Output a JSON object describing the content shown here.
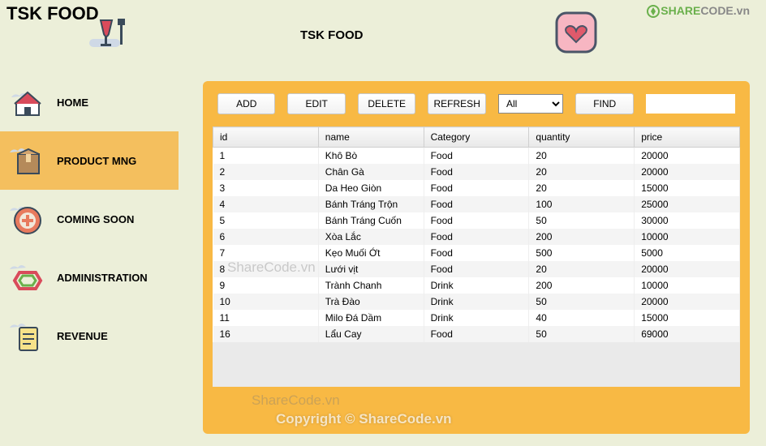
{
  "brand": "TSK FOOD",
  "title": "TSK FOOD",
  "logo_right": {
    "a": "SHARE",
    "b": "CODE",
    "c": ".vn"
  },
  "sidebar": {
    "items": [
      {
        "label": "HOME"
      },
      {
        "label": "PRODUCT MNG"
      },
      {
        "label": "COMING SOON"
      },
      {
        "label": "ADMINISTRATION"
      },
      {
        "label": "REVENUE"
      }
    ]
  },
  "toolbar": {
    "add": "ADD",
    "edit": "EDIT",
    "delete": "DELETE",
    "refresh": "REFRESH",
    "filter_selected": "All",
    "find": "FIND",
    "search_value": ""
  },
  "table": {
    "headers": [
      "id",
      "name",
      "Category",
      "quantity",
      "price"
    ],
    "rows": [
      {
        "id": "1",
        "name": "Khô Bò",
        "category": "Food",
        "quantity": "20",
        "price": "20000"
      },
      {
        "id": "2",
        "name": "Chân Gà",
        "category": "Food",
        "quantity": "20",
        "price": "20000"
      },
      {
        "id": "3",
        "name": "Da Heo Giòn",
        "category": "Food",
        "quantity": "20",
        "price": "15000"
      },
      {
        "id": "4",
        "name": "Bánh Tráng Trộn",
        "category": "Food",
        "quantity": "100",
        "price": "25000"
      },
      {
        "id": "5",
        "name": "Bánh Tráng Cuốn",
        "category": "Food",
        "quantity": "50",
        "price": "30000"
      },
      {
        "id": "6",
        "name": "Xòa Lắc",
        "category": "Food",
        "quantity": "200",
        "price": "10000"
      },
      {
        "id": "7",
        "name": "Kẹo Muối Ớt",
        "category": "Food",
        "quantity": "500",
        "price": "5000"
      },
      {
        "id": "8",
        "name": "Lưới vịt",
        "category": "Food",
        "quantity": "20",
        "price": "20000"
      },
      {
        "id": "9",
        "name": "Trành Chanh",
        "category": "Drink",
        "quantity": "200",
        "price": "10000"
      },
      {
        "id": "10",
        "name": "Trà Đào",
        "category": "Drink",
        "quantity": "50",
        "price": "20000"
      },
      {
        "id": "11",
        "name": "Milo Đá Dầm",
        "category": "Drink",
        "quantity": "40",
        "price": "15000"
      },
      {
        "id": "16",
        "name": "Lẩu Cay",
        "category": "Food",
        "quantity": "50",
        "price": "69000"
      }
    ]
  },
  "watermarks": {
    "w1": "ShareCode.vn",
    "w2": "ShareCode.vn",
    "w3": "Copyright © ShareCode.vn"
  }
}
